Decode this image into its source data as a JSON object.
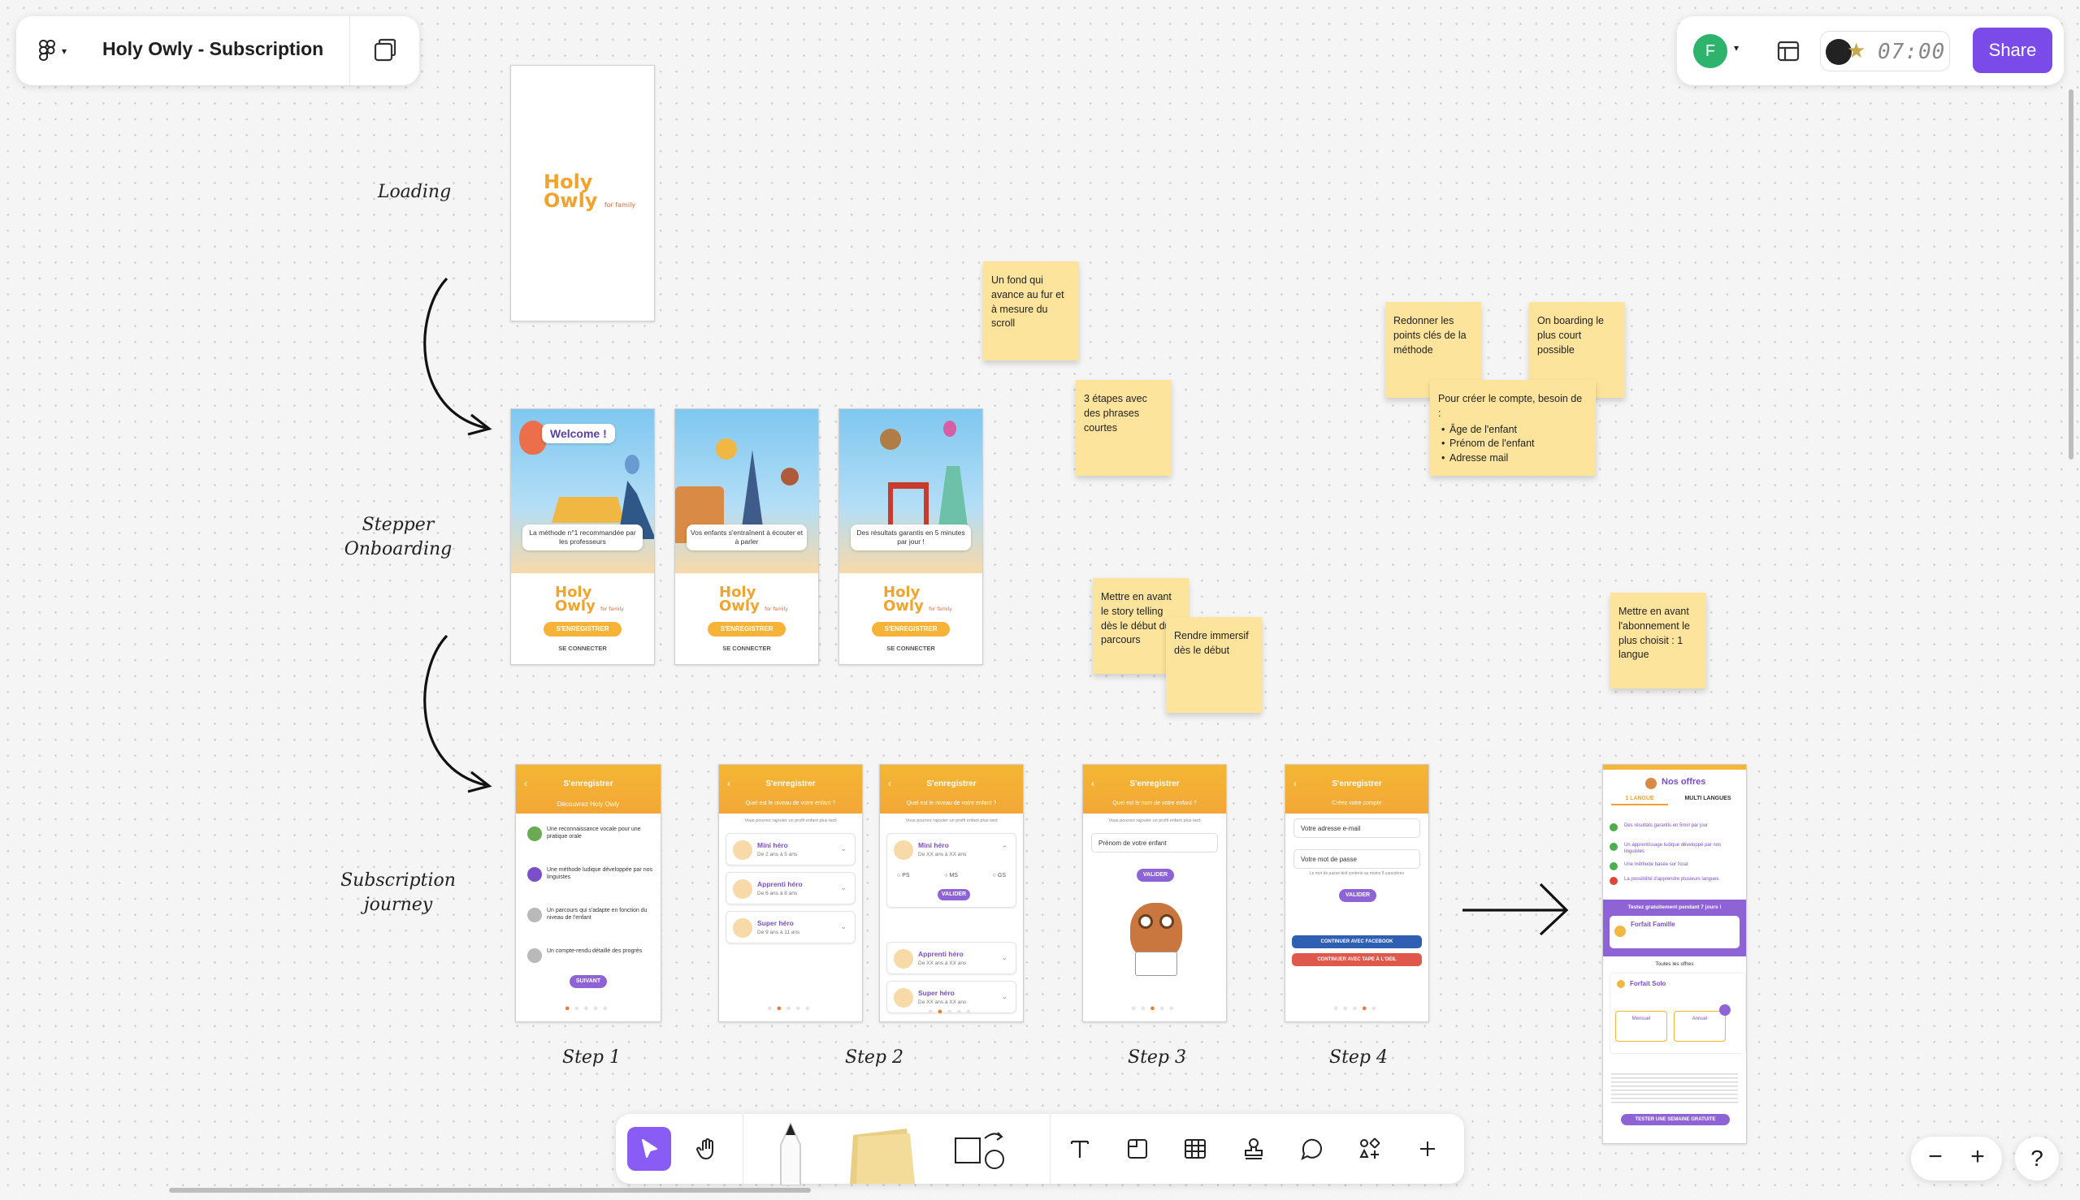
{
  "header": {
    "file_name": "Holy Owly - Subscription",
    "menu_icon": "figma-logo-icon",
    "pages_icon": "pages-icon"
  },
  "toolbar_right": {
    "avatar_letter": "F",
    "avatar_color": "#2db36b",
    "timer": "07:00",
    "share_label": "Share",
    "share_color": "#7b4bea"
  },
  "canvas": {
    "section_labels": {
      "loading": "Loading",
      "stepper": "Stepper\nOnboarding",
      "subscription": "Subscription\njourney"
    },
    "step_labels": [
      "Step 1",
      "Step 2",
      "Step 3",
      "Step 4"
    ],
    "stickies": {
      "s1": "Un fond qui avance au fur et à mesure du scroll",
      "s2": "3 étapes avec des phrases courtes",
      "s3": "Mettre en avant le story telling dès le début du parcours",
      "s4": "Rendre immersif dès le début",
      "s5": "Redonner les points clés de la méthode",
      "s6": "On boarding le plus court possible",
      "s7_title": "Pour créer le compte, besoin de :",
      "s7_items": [
        "Âge de l'enfant",
        "Prénom de l'enfant",
        "Adresse mail"
      ],
      "s8": "Mettre en avant l'abonnement le plus choisit : 1 langue"
    },
    "frames": {
      "logo_line1": "Holy",
      "logo_line2": "Owly",
      "logo_tag": "for family",
      "welcome": "Welcome !",
      "ob_captions": [
        "La méthode n°1 recommandée par les professeurs",
        "Vos enfants s'entraînent à écouter et à parler",
        "Des résultats garantis en 5 minutes par jour !"
      ],
      "ob_btn": "S'ENREGISTRER",
      "ob_link": "SE CONNECTER",
      "register_title": "S'enregistrer",
      "step1_sub": "Découvrez Holy Owly",
      "step1_items": [
        "Une reconnaissance vocale pour une pratique orale",
        "Une méthode ludique développée par nos linguistes",
        "Un parcours qui s'adapte en fonction du niveau de l'enfant",
        "Un compte-rendu détaillé des progrès"
      ],
      "step1_btn": "SUIVANT",
      "step2_sub": "Quel est le niveau de votre enfant ?",
      "step2_hint": "Vous pourrez rajouter un profil enfant plus tard",
      "levels": [
        {
          "name": "Mini héro",
          "age": "De 2 ans à 5 ans"
        },
        {
          "name": "Apprenti héro",
          "age": "De 6 ans à 8 ans"
        },
        {
          "name": "Super héro",
          "age": "De 9 ans à 11 ans"
        }
      ],
      "levels_b": [
        {
          "name": "Mini héro",
          "age": "De XX ans à XX ans"
        },
        {
          "name": "Apprenti héro",
          "age": "De XX ans à XX ans"
        },
        {
          "name": "Super héro",
          "age": "De XX ans à XX ans"
        }
      ],
      "grades": [
        "PS",
        "MS",
        "GS"
      ],
      "validate": "VALIDER",
      "step3_sub": "Quel est le nom de votre enfant ?",
      "step3_field": "Prénom de votre enfant",
      "step4_sub": "Créez votre compte",
      "step4_email": "Votre adresse e-mail",
      "step4_pwd": "Votre mot de passe",
      "step4_pwd_hint": "Le mot de passe doit contenir au moins 8 caractères",
      "fb_btn": "CONTINUER AVEC FACEBOOK",
      "google_btn": "CONTINUER AVEC TAPE À L'OEIL",
      "offers_title": "Nos offres",
      "offers_tabs": [
        "1 LANGUE",
        "MULTI LANGUES"
      ],
      "offers_features": [
        "Des résultats garantis en 5min par jour",
        "Un apprentissage ludique développé par nos linguistes",
        "Une méthode basée sur l'oral",
        "La possibilité d'apprendre plusieurs langues"
      ],
      "offers_trial": "Testez gratuitement pendant 7 jours !",
      "offer_family": "Forfait Famille",
      "offers_all": "Toutes les offres",
      "offer_solo": "Forfait Solo",
      "offer_monthly": "Mensuel",
      "offer_yearly": "Annuel",
      "offers_cta": "TESTER UNE SEMAINE GRATUITE"
    }
  },
  "bottom_toolbar": {
    "tools": [
      "cursor-icon",
      "hand-icon",
      "pen-icon",
      "sticky-note-icon",
      "shapes-icon",
      "text-icon",
      "section-icon",
      "table-icon",
      "stamp-icon",
      "comment-icon",
      "widgets-icon",
      "plus-icon"
    ],
    "active_color": "#8a5cf6"
  },
  "zoom_controls": [
    "−",
    "+",
    "?"
  ]
}
